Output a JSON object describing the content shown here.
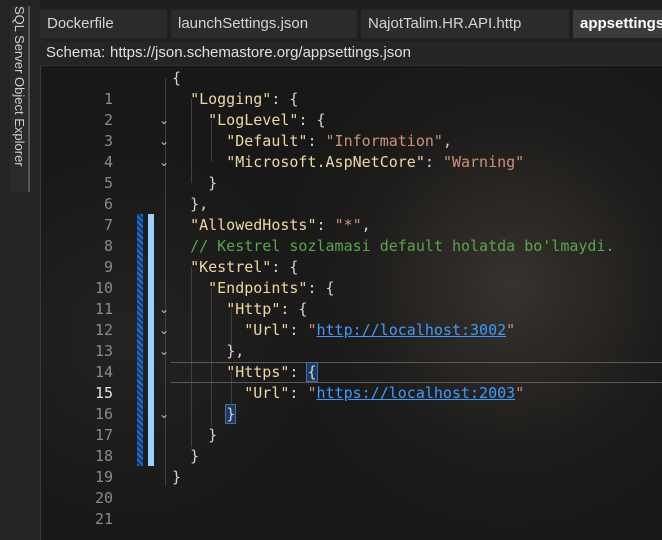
{
  "sidebar": {
    "vertical_tab_label": "SQL Server Object Explorer"
  },
  "tabs": [
    {
      "label": "Dockerfile",
      "active": false
    },
    {
      "label": "launchSettings.json",
      "active": false
    },
    {
      "label": "NajotTalim.HR.API.http",
      "active": false
    },
    {
      "label": "appsettings",
      "active": true
    }
  ],
  "schema": {
    "label": "Schema:",
    "url": "https://json.schemastore.org/appsettings.json"
  },
  "editor": {
    "current_line": 15,
    "lines": [
      {
        "n": "1"
      },
      {
        "n": "2"
      },
      {
        "n": "3"
      },
      {
        "n": "4"
      },
      {
        "n": "5"
      },
      {
        "n": "6"
      },
      {
        "n": "7"
      },
      {
        "n": "8"
      },
      {
        "n": "9"
      },
      {
        "n": "10"
      },
      {
        "n": "11"
      },
      {
        "n": "12"
      },
      {
        "n": "13"
      },
      {
        "n": "14"
      },
      {
        "n": "15"
      },
      {
        "n": "16"
      },
      {
        "n": "17"
      },
      {
        "n": "18"
      },
      {
        "n": "19"
      },
      {
        "n": "20"
      },
      {
        "n": "21"
      }
    ],
    "tokens": {
      "l1_brace": "{",
      "l2_key": "\"Logging\"",
      "l2_rest": ": {",
      "l3_key": "\"LogLevel\"",
      "l3_rest": ": {",
      "l4_key": "\"Default\"",
      "l4_colon": ": ",
      "l4_val": "\"Information\"",
      "l4_comma": ",",
      "l5_key": "\"Microsoft.AspNetCore\"",
      "l5_colon": ": ",
      "l5_val": "\"Warning\"",
      "l6": "}",
      "l7": "},",
      "l8_key": "\"AllowedHosts\"",
      "l8_colon": ": ",
      "l8_val": "\"*\"",
      "l8_comma": ",",
      "l9_comment": "// Kestrel sozlamasi default holatda bo'lmaydi.",
      "l10_key": "\"Kestrel\"",
      "l10_rest": ": {",
      "l11_key": "\"Endpoints\"",
      "l11_rest": ": {",
      "l12_key": "\"Http\"",
      "l12_rest": ": {",
      "l13_key": "\"Url\"",
      "l13_colon": ": ",
      "l13_q1": "\"",
      "l13_url": "http://localhost:3002",
      "l13_q2": "\"",
      "l14": "},",
      "l15_key": "\"Https\"",
      "l15_colon": ": ",
      "l15_brace": "{",
      "l16_key": "\"Url\"",
      "l16_colon": ": ",
      "l16_q1": "\"",
      "l16_url": "https://localhost:2003",
      "l16_q2": "\"",
      "l17": "}",
      "l18": "}",
      "l19": "}",
      "l20": "}"
    }
  },
  "colors": {
    "accent": "#3b9cff",
    "string": "#ce9178",
    "key": "#efd79e",
    "comment": "#57a64a",
    "change_marker": "#1c6fd6"
  }
}
